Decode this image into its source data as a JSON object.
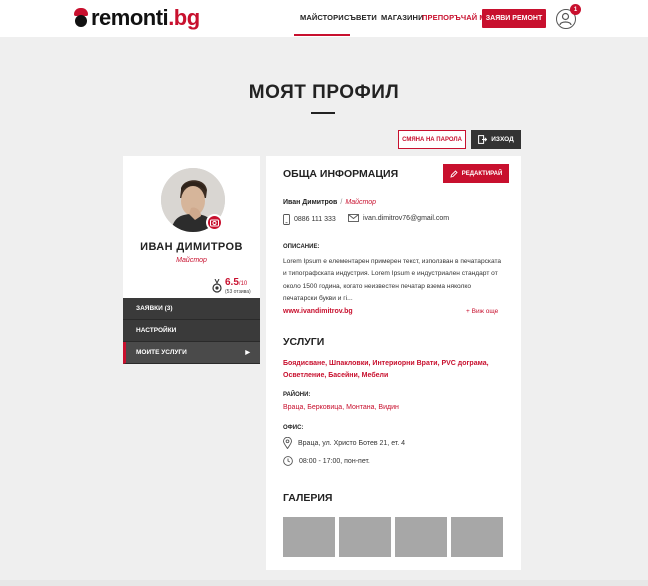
{
  "header": {
    "logo_text": "remonti",
    "logo_tld": ".bg",
    "nav": [
      "Майстори",
      "Съвети",
      "Магазини",
      "Препоръчай ми"
    ],
    "cta_label": "Заяви ремонт",
    "notification_count": "1"
  },
  "page": {
    "title": "Моят профил",
    "change_password_label": "Смяна на парола",
    "logout_label": "Изход"
  },
  "profile": {
    "name": "Иван Димитров",
    "role": "Майстор",
    "rating": "6.5",
    "rating_max": "/10",
    "reviews": "(53 отзива)",
    "menu": [
      "Заявки (3)",
      "Настройки",
      "Моите услуги"
    ]
  },
  "info": {
    "title": "Обща информация",
    "edit_label": "Редактирай",
    "name": "Иван Димитров",
    "role": "Майстор",
    "phone": "0886 111 333",
    "email": "ivan.dimitrov76@gmail.com",
    "description_label": "Описание:",
    "description": "Lorem Ipsum е елементарен примерен текст, използван в печатарската и типографската индустрия. Lorem Ipsum е индустриален стандарт от около 1500 година, когато неизвестен печатар взема няколко печатарски букви и гi...",
    "website": "www.ivandimitrov.bg",
    "see_more": "Виж още"
  },
  "services": {
    "title": "Услуги",
    "list": "Боядисване, Шпакловки, Интериорни Врати, PVC дограма, Осветление, Басейни, Мебели",
    "areas_label": "Райони:",
    "areas": "Враца, Берковица, Монтана, Видин",
    "office_label": "Офис:",
    "address": "Враца, ул. Христо Ботев 21, ет. 4",
    "hours": "08:00 - 17:00, пон-пет."
  },
  "gallery": {
    "title": "Галерия",
    "count": 4
  },
  "colors": {
    "accent": "#c8102e",
    "dark": "#3a3a3a",
    "background": "#efefef"
  }
}
